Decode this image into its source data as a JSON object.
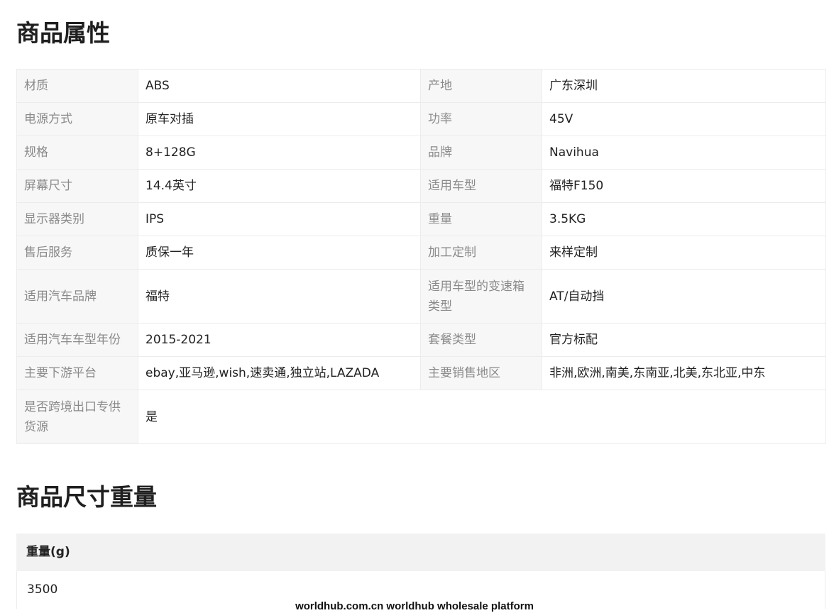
{
  "sections": {
    "attributes_title": "商品属性",
    "dimensions_title": "商品尺寸重量"
  },
  "attributes": [
    {
      "k1": "材质",
      "v1": "ABS",
      "k2": "产地",
      "v2": "广东深圳"
    },
    {
      "k1": "电源方式",
      "v1": "原车对插",
      "k2": "功率",
      "v2": "45V"
    },
    {
      "k1": "规格",
      "v1": "8+128G",
      "k2": "品牌",
      "v2": "Navihua"
    },
    {
      "k1": "屏幕尺寸",
      "v1": "14.4英寸",
      "k2": "适用车型",
      "v2": "福特F150"
    },
    {
      "k1": "显示器类别",
      "v1": "IPS",
      "k2": "重量",
      "v2": "3.5KG"
    },
    {
      "k1": "售后服务",
      "v1": "质保一年",
      "k2": "加工定制",
      "v2": "来样定制"
    },
    {
      "k1": "适用汽车品牌",
      "v1": "福特",
      "k2": "适用车型的变速箱类型",
      "v2": "AT/自动挡"
    },
    {
      "k1": "适用汽车车型年份",
      "v1": "2015-2021",
      "k2": "套餐类型",
      "v2": "官方标配"
    },
    {
      "k1": "主要下游平台",
      "v1": "ebay,亚马逊,wish,速卖通,独立站,LAZADA",
      "k2": "主要销售地区",
      "v2": "非洲,欧洲,南美,东南亚,北美,东北亚,中东"
    },
    {
      "k1": "是否跨境出口专供货源",
      "v1": "是"
    }
  ],
  "dimensions": {
    "header": "重量(g)",
    "value": "3500"
  },
  "watermark": "worldhub.com.cn worldhub wholesale platform"
}
